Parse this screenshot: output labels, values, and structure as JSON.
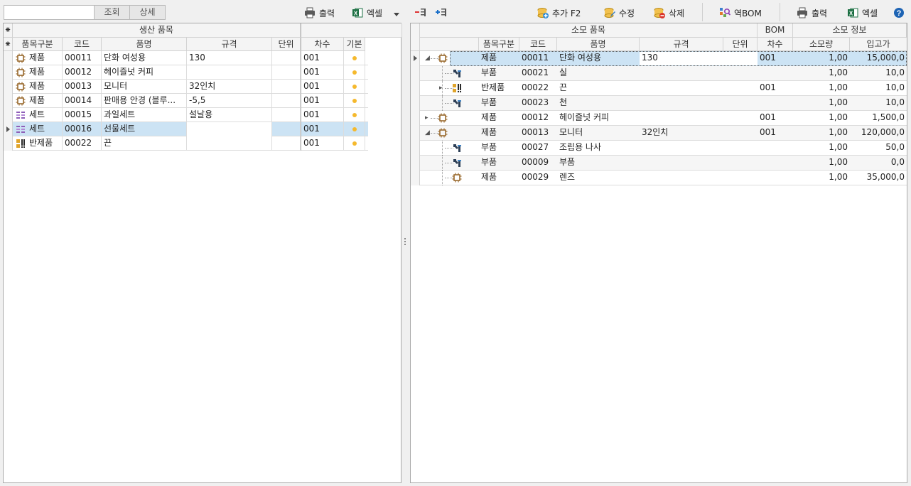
{
  "toolbar_left": {
    "search_value": "",
    "search_button": "조회",
    "detail_button": "상세",
    "print_label": "출력",
    "excel_label": "엑셀"
  },
  "toolbar_right": {
    "add_label": "추가 F2",
    "edit_label": "수정",
    "delete_label": "삭제",
    "reverse_bom_label": "역BOM",
    "print_label": "출력",
    "excel_label": "엑셀"
  },
  "left_grid": {
    "band_title": "생산 품목",
    "columns": [
      "품목구분",
      "코드",
      "품명",
      "규격",
      "단위",
      "차수",
      "기본"
    ],
    "rows": [
      {
        "type": "제품",
        "icon": "product-icon",
        "code": "00011",
        "name": "단화 여성용",
        "spec": "130",
        "unit": "",
        "rev": "001",
        "default": true,
        "selected": false
      },
      {
        "type": "제품",
        "icon": "product-icon",
        "code": "00012",
        "name": "헤이즐넛 커피",
        "spec": "",
        "unit": "",
        "rev": "001",
        "default": true,
        "selected": false
      },
      {
        "type": "제품",
        "icon": "product-icon",
        "code": "00013",
        "name": "모니터",
        "spec": "32인치",
        "unit": "",
        "rev": "001",
        "default": true,
        "selected": false
      },
      {
        "type": "제품",
        "icon": "product-icon",
        "code": "00014",
        "name": "판매용 안경 (블루...",
        "spec": "-5,5",
        "unit": "",
        "rev": "001",
        "default": true,
        "selected": false
      },
      {
        "type": "세트",
        "icon": "set-icon",
        "code": "00015",
        "name": "과일세트",
        "spec": "설날용",
        "unit": "",
        "rev": "001",
        "default": true,
        "selected": false
      },
      {
        "type": "세트",
        "icon": "set-icon",
        "code": "00016",
        "name": "선물세트",
        "spec": "",
        "unit": "",
        "rev": "001",
        "default": true,
        "selected": true
      },
      {
        "type": "반제품",
        "icon": "semi-product-icon",
        "code": "00022",
        "name": "끈",
        "spec": "",
        "unit": "",
        "rev": "001",
        "default": true,
        "selected": false
      }
    ]
  },
  "right_grid": {
    "band_title": "소모 품목",
    "band_bom": "BOM",
    "band_info": "소모 정보",
    "columns": [
      "품목구분",
      "코드",
      "품명",
      "규격",
      "단위",
      "차수",
      "소모량",
      "입고가"
    ],
    "rows": [
      {
        "level": 0,
        "expander": "expanded",
        "type": "제품",
        "icon": "product-icon",
        "code": "00011",
        "name": "단화 여성용",
        "spec": "130",
        "unit": "",
        "rev": "001",
        "qty": "1,00",
        "price": "15,000,0",
        "selected": true
      },
      {
        "level": 1,
        "expander": "",
        "type": "부품",
        "icon": "part-icon",
        "code": "00021",
        "name": "실",
        "spec": "",
        "unit": "",
        "rev": "",
        "qty": "1,00",
        "price": "10,0",
        "selected": false
      },
      {
        "level": 1,
        "expander": "collapsed",
        "type": "반제품",
        "icon": "semi-product-icon",
        "code": "00022",
        "name": "끈",
        "spec": "",
        "unit": "",
        "rev": "001",
        "qty": "1,00",
        "price": "10,0",
        "selected": false
      },
      {
        "level": 1,
        "expander": "",
        "type": "부품",
        "icon": "part-icon",
        "code": "00023",
        "name": "천",
        "spec": "",
        "unit": "",
        "rev": "",
        "qty": "1,00",
        "price": "10,0",
        "selected": false
      },
      {
        "level": 0,
        "expander": "collapsed",
        "type": "제품",
        "icon": "product-icon",
        "code": "00012",
        "name": "헤이즐넛 커피",
        "spec": "",
        "unit": "",
        "rev": "001",
        "qty": "1,00",
        "price": "1,500,0",
        "selected": false
      },
      {
        "level": 0,
        "expander": "expanded",
        "type": "제품",
        "icon": "product-icon",
        "code": "00013",
        "name": "모니터",
        "spec": "32인치",
        "unit": "",
        "rev": "001",
        "qty": "1,00",
        "price": "120,000,0",
        "selected": false
      },
      {
        "level": 1,
        "expander": "",
        "type": "부품",
        "icon": "part-icon",
        "code": "00027",
        "name": "조립용 나사",
        "spec": "",
        "unit": "",
        "rev": "",
        "qty": "1,00",
        "price": "50,0",
        "selected": false
      },
      {
        "level": 1,
        "expander": "",
        "type": "부품",
        "icon": "part-icon",
        "code": "00009",
        "name": "부품",
        "spec": "",
        "unit": "",
        "rev": "",
        "qty": "1,00",
        "price": "0,0",
        "selected": false
      },
      {
        "level": 1,
        "expander": "",
        "type": "제품",
        "icon": "product-icon",
        "code": "00029",
        "name": "렌즈",
        "spec": "",
        "unit": "",
        "rev": "",
        "qty": "1,00",
        "price": "35,000,0",
        "selected": false
      }
    ]
  },
  "colors": {
    "selection": "#cce3f4",
    "default_dot": "#f5b92d",
    "help_icon": "#1e64b4"
  }
}
